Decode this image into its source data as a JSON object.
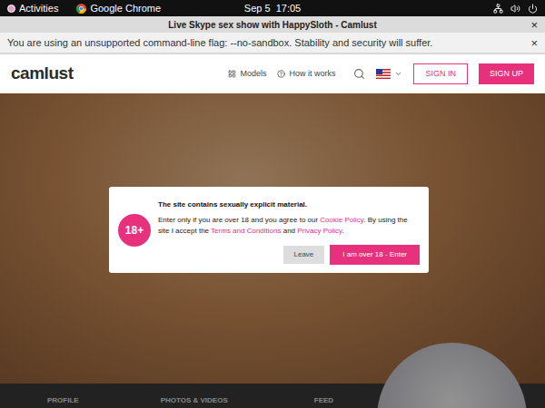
{
  "system_bar": {
    "activities": "Activities",
    "app": "Google Chrome",
    "clock": "Sep 5  17:05"
  },
  "browser": {
    "title": "Live Skype sex show with HappySloth - Camlust",
    "close": "×",
    "infobar": {
      "message": "You are using an unsupported command-line flag: --no-sandbox. Stability and security will suffer.",
      "close": "×"
    }
  },
  "site": {
    "logo": "camlust",
    "nav": [
      {
        "label": "Models"
      },
      {
        "label": "How it works"
      }
    ],
    "sign_in": "SIGN IN",
    "sign_up": "SIGN UP",
    "profile_tabs": [
      "PROFILE",
      "PHOTOS & VIDEOS",
      "FEED"
    ]
  },
  "modal": {
    "badge": "18+",
    "title": "The site contains sexually explicit material.",
    "body": [
      {
        "text": "Enter only if you are over 18 and you agree to our ",
        "link": false
      },
      {
        "text": "Cookie Policy",
        "link": true
      },
      {
        "text": ". By using the site I accept the ",
        "link": false
      },
      {
        "text": "Terms and Conditions",
        "link": true
      },
      {
        "text": " and ",
        "link": false
      },
      {
        "text": "Privacy Policy",
        "link": true
      },
      {
        "text": ".",
        "link": false
      }
    ],
    "buttons": [
      {
        "label": "Leave",
        "primary": false
      },
      {
        "label": "I am over 18 - Enter",
        "primary": true
      }
    ]
  }
}
